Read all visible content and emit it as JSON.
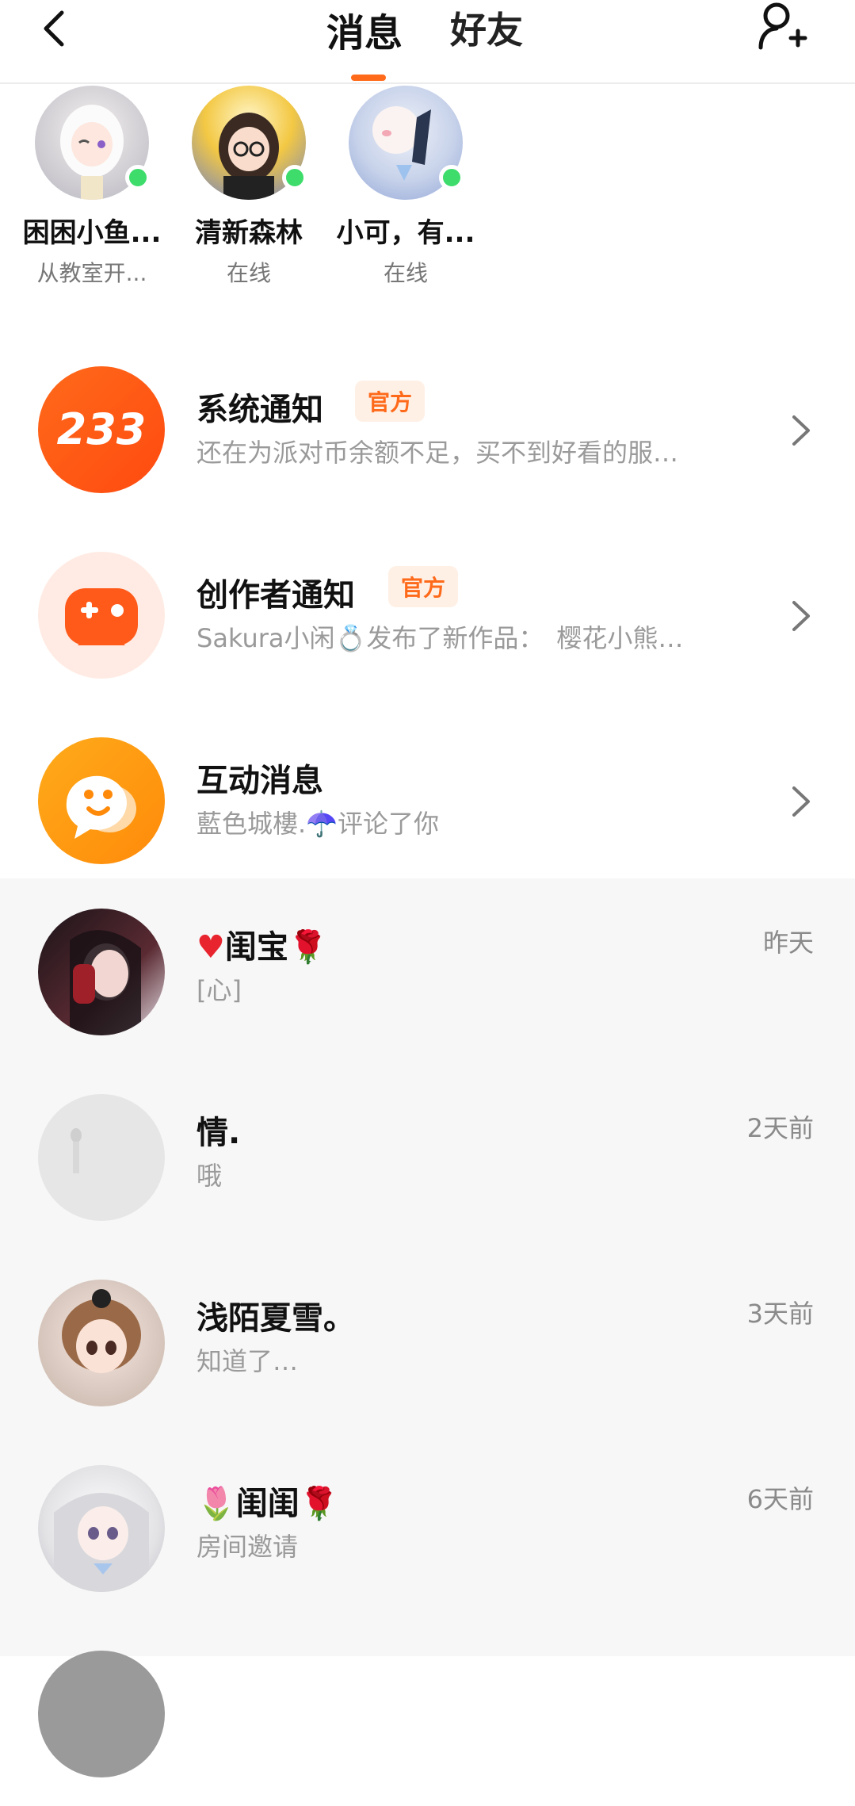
{
  "header": {
    "tab_messages": "消息",
    "tab_friends": "好友",
    "accent_color": "#ff6a1a"
  },
  "online_friends": [
    {
      "name": "困困小鱼...",
      "status": "从教室开..."
    },
    {
      "name": "清新森林",
      "status": "在线"
    },
    {
      "name": "小可，有...",
      "status": "在线"
    }
  ],
  "notifications": [
    {
      "title": "系统通知",
      "badge": "官方",
      "preview": "还在为派对币余额不足，买不到好看的服…",
      "icon_text": "233",
      "icon": "logo-233-icon"
    },
    {
      "title": "创作者通知",
      "badge": "官方",
      "preview": "Sakura小闲💍发布了新作品：　樱花小熊…",
      "icon": "gamepad-plus-icon"
    },
    {
      "title": "互动消息",
      "preview": "藍色城樓.☂️评论了你",
      "icon": "chat-bubble-icon"
    }
  ],
  "conversations": [
    {
      "name_prefix": "♥",
      "name": "闺宝",
      "name_suffix": "🌹",
      "message": "[心]",
      "time": "昨天"
    },
    {
      "name_prefix": "",
      "name": "情.",
      "name_suffix": "",
      "message": "哦",
      "time": "2天前"
    },
    {
      "name_prefix": "",
      "name": "浅陌夏雪。",
      "name_suffix": "",
      "message": "知道了…",
      "time": "3天前"
    },
    {
      "name_prefix": "🌷",
      "name": "闺闺",
      "name_suffix": "🌹",
      "message": "房间邀请",
      "time": "6天前"
    }
  ]
}
